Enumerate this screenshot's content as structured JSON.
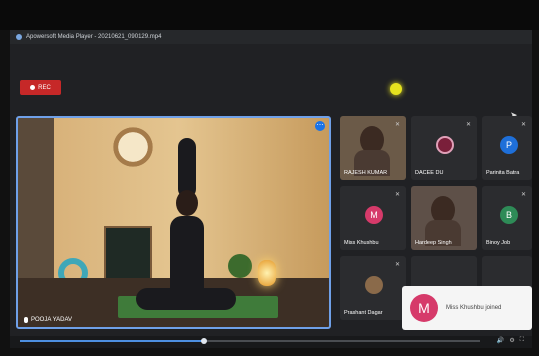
{
  "window": {
    "title": "Apowersoft Media Player - 20210621_090129.mp4"
  },
  "rec_button": {
    "label": "REC"
  },
  "main_video": {
    "name": "POOJA YADAV"
  },
  "tiles": [
    {
      "name": "RAJESH KUMAR",
      "kind": "video"
    },
    {
      "name": "DACEE DU",
      "kind": "avatar",
      "initial": "",
      "color": "#7a1f3a"
    },
    {
      "name": "Parinita Batra",
      "kind": "avatar",
      "initial": "P",
      "color": "#1e6fd9"
    },
    {
      "name": "Miss Khushbu",
      "kind": "avatar",
      "initial": "M",
      "color": "#d63a6a"
    },
    {
      "name": "Hardeep Singh",
      "kind": "video"
    },
    {
      "name": "Binoy Job",
      "kind": "avatar",
      "initial": "B",
      "color": "#2e8b57"
    },
    {
      "name": "Prashant Dagar",
      "kind": "avatar",
      "initial": "",
      "color": "#8a6a4a"
    }
  ],
  "toast": {
    "initial": "M",
    "message": "Miss Khushbu joined",
    "color": "#d63a6a"
  },
  "player": {
    "progress": 0.4
  },
  "colors": {
    "accent": "#1a73e8",
    "rec": "#c62828",
    "active_border": "#6fa0e8"
  }
}
